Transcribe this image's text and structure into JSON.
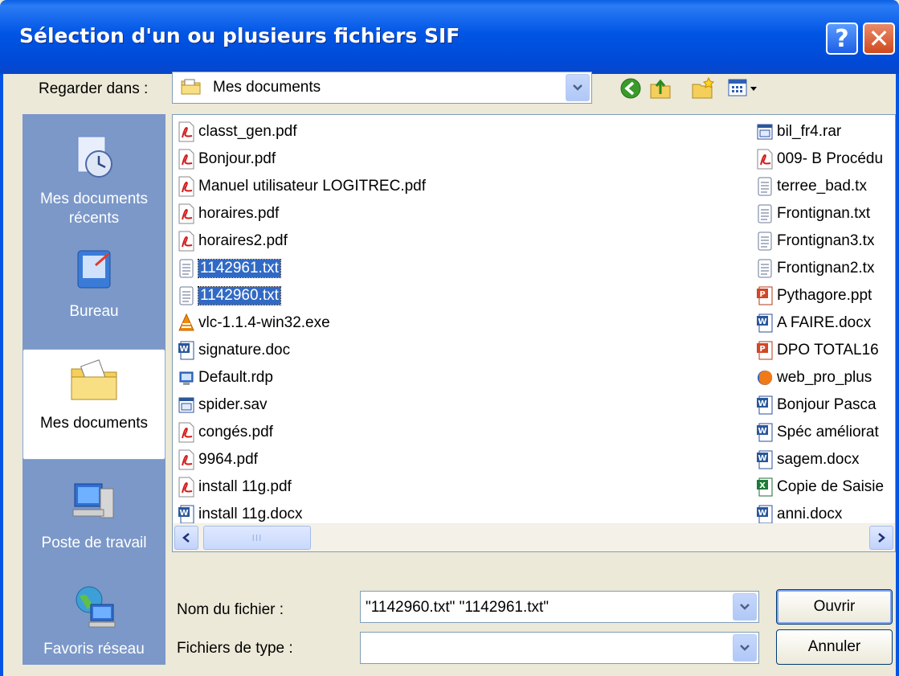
{
  "window": {
    "title": "Sélection d'un ou plusieurs fichiers SIF",
    "help_label": "?",
    "close_label": "✕"
  },
  "lookin": {
    "label": "Regarder dans :",
    "value": "Mes documents"
  },
  "toolbar": {
    "back_icon": "back-arrow-icon",
    "up_icon": "up-folder-icon",
    "new_icon": "new-folder-icon",
    "view_icon": "view-menu-icon"
  },
  "places": [
    {
      "label": "Mes documents récents",
      "icon": "recent-documents-icon"
    },
    {
      "label": "Bureau",
      "icon": "desktop-icon"
    },
    {
      "label": "Mes documents",
      "icon": "my-documents-icon"
    },
    {
      "label": "Poste de travail",
      "icon": "my-computer-icon"
    },
    {
      "label": "Favoris réseau",
      "icon": "network-places-icon"
    }
  ],
  "files_left": [
    {
      "name": "classt_gen.pdf",
      "type": "pdf"
    },
    {
      "name": "Bonjour.pdf",
      "type": "pdf"
    },
    {
      "name": "Manuel utilisateur LOGITREC.pdf",
      "type": "pdf"
    },
    {
      "name": "horaires.pdf",
      "type": "pdf"
    },
    {
      "name": "horaires2.pdf",
      "type": "pdf"
    },
    {
      "name": "1142961.txt",
      "type": "txt",
      "selected": true
    },
    {
      "name": "1142960.txt",
      "type": "txt",
      "selected": true
    },
    {
      "name": "vlc-1.1.4-win32.exe",
      "type": "vlc"
    },
    {
      "name": "signature.doc",
      "type": "doc"
    },
    {
      "name": "Default.rdp",
      "type": "rdp"
    },
    {
      "name": "spider.sav",
      "type": "sav"
    },
    {
      "name": "congés.pdf",
      "type": "pdf"
    },
    {
      "name": "9964.pdf",
      "type": "pdf"
    },
    {
      "name": "install 11g.pdf",
      "type": "pdf"
    },
    {
      "name": "install 11g.docx",
      "type": "doc"
    }
  ],
  "files_right": [
    {
      "name": "bil_fr4.rar",
      "type": "sav"
    },
    {
      "name": "009- B Procédu",
      "type": "pdf"
    },
    {
      "name": "terree_bad.tx",
      "type": "txt"
    },
    {
      "name": "Frontignan.txt",
      "type": "txt"
    },
    {
      "name": "Frontignan3.tx",
      "type": "txt"
    },
    {
      "name": "Frontignan2.tx",
      "type": "txt"
    },
    {
      "name": "Pythagore.ppt",
      "type": "ppt"
    },
    {
      "name": "A FAIRE.docx",
      "type": "doc"
    },
    {
      "name": "DPO TOTAL16",
      "type": "ppt"
    },
    {
      "name": "web_pro_plus",
      "type": "firefox"
    },
    {
      "name": "Bonjour Pasca",
      "type": "doc"
    },
    {
      "name": "Spéc améliorat",
      "type": "doc"
    },
    {
      "name": "sagem.docx",
      "type": "doc"
    },
    {
      "name": "Copie de Saisie",
      "type": "xls"
    },
    {
      "name": "anni.docx",
      "type": "doc"
    }
  ],
  "scrollbar": {
    "thumb_grip": "III"
  },
  "filename": {
    "label": "Nom du fichier :",
    "value": "\"1142960.txt\" \"1142961.txt\""
  },
  "filetype": {
    "label": "Fichiers de type :",
    "value": ""
  },
  "buttons": {
    "open": "Ouvrir",
    "cancel": "Annuler"
  }
}
